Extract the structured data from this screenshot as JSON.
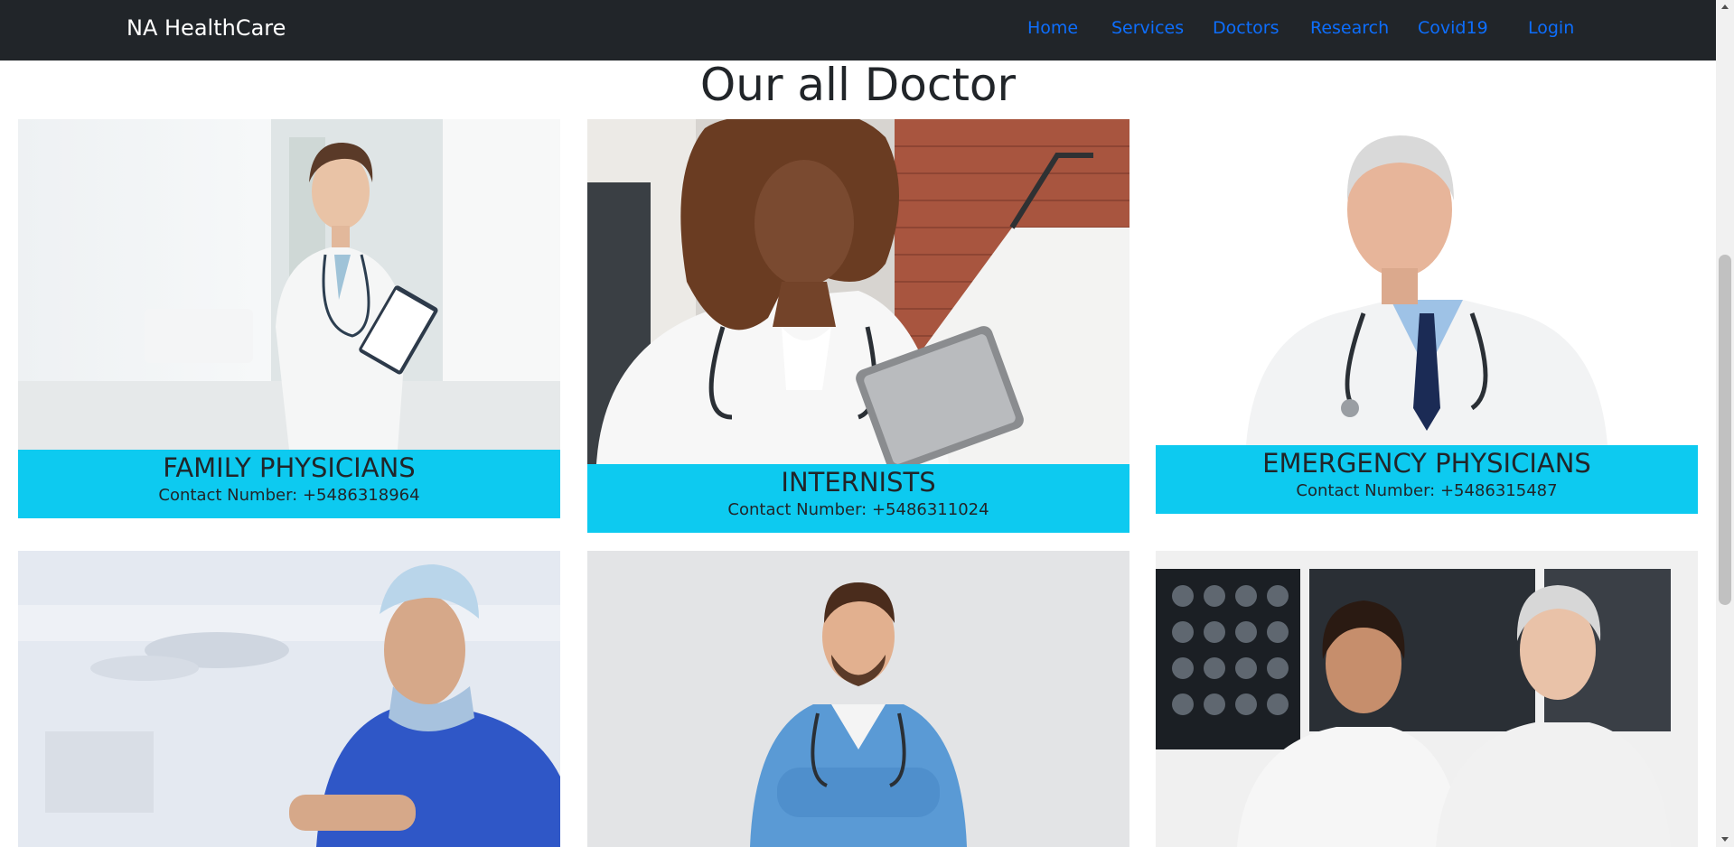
{
  "nav": {
    "brand": "NA HealthCare",
    "links": [
      "Home",
      "Services",
      "Doctors",
      "Research",
      "Covid19",
      "Login"
    ]
  },
  "page": {
    "heading": "Our all Doctor"
  },
  "doctors": [
    {
      "title": "FAMILY PHYSICIANS",
      "contact": "Contact Number: +5486318964"
    },
    {
      "title": "INTERNISTS",
      "contact": "Contact Number: +5486311024"
    },
    {
      "title": "EMERGENCY PHYSICIANS",
      "contact": "Contact Number: +5486315487"
    }
  ],
  "colors": {
    "navbar_bg": "#212529",
    "link": "#0d6efd",
    "caption_bg": "#0dcaf0",
    "text": "#212529"
  }
}
